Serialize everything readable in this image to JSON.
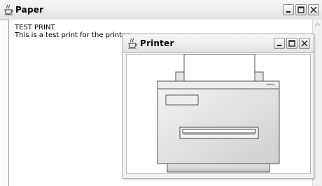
{
  "paper_window": {
    "title": "Paper",
    "icon": "java-cup-icon",
    "text_lines": [
      "TEST PRINT",
      "This is a test print for the printer."
    ]
  },
  "printer_window": {
    "title": "Printer",
    "icon": "java-cup-icon",
    "illustration": "printer-icon"
  }
}
